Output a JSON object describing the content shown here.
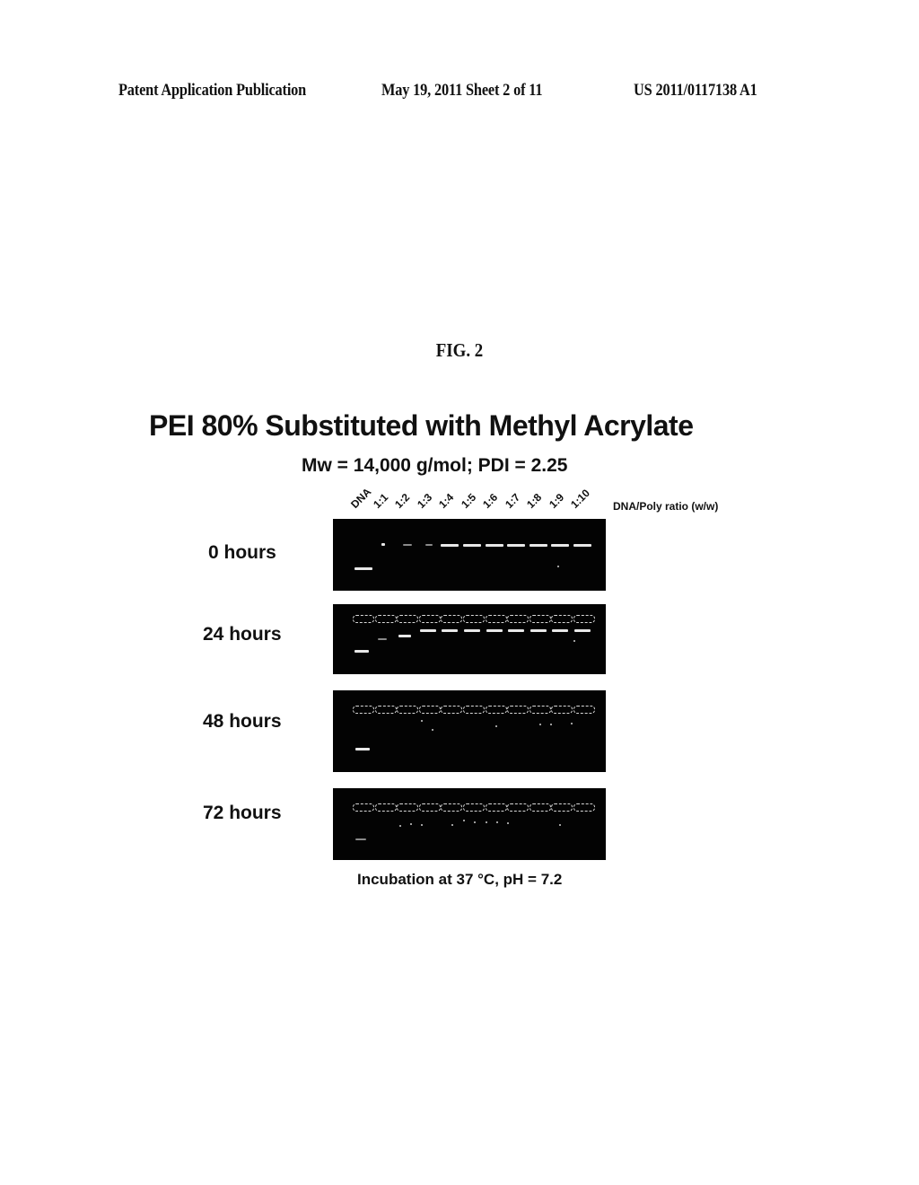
{
  "header": {
    "left": "Patent Application Publication",
    "middle": "May 19, 2011  Sheet 2 of 11",
    "right": "US 2011/0117138 A1"
  },
  "figure": {
    "label": "FIG. 2",
    "title": "PEI 80% Substituted with Methyl Acrylate",
    "subtitle": "Mw = 14,000 g/mol; PDI = 2.25",
    "lane_labels": [
      "DNA",
      "1:1",
      "1:2",
      "1:3",
      "1:4",
      "1:5",
      "1:6",
      "1:7",
      "1:8",
      "1:9",
      "1:10"
    ],
    "ratio_axis_label": "DNA/Poly ratio (w/w)",
    "rows": [
      {
        "label": "0 hours",
        "wells_visible": false
      },
      {
        "label": "24 hours",
        "wells_visible": true
      },
      {
        "label": "48 hours",
        "wells_visible": true
      },
      {
        "label": "72 hours",
        "wells_visible": true
      }
    ],
    "caption": "Incubation at 37 °C, pH = 7.2"
  }
}
